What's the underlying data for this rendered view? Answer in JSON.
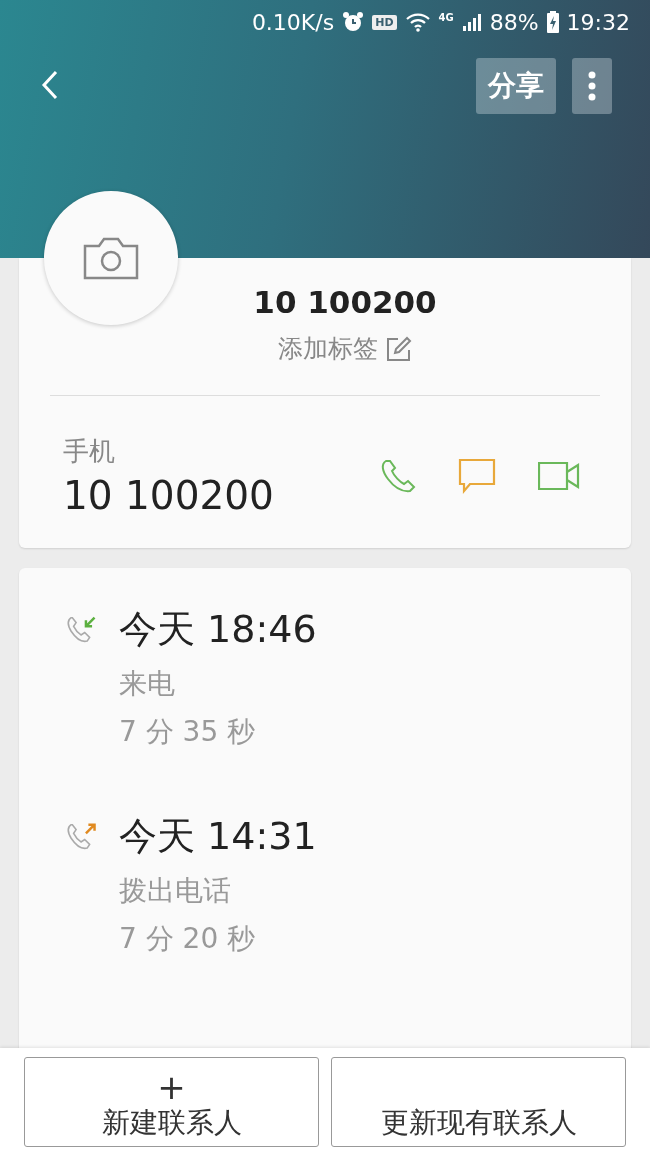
{
  "status_bar": {
    "speed": "0.10K/s",
    "hd": "HD",
    "network": "4G",
    "battery": "88%",
    "time": "19:32"
  },
  "toolbar": {
    "share": "分享"
  },
  "contact": {
    "name": "10 100200",
    "tag_hint": "添加标签"
  },
  "phone": {
    "label": "手机",
    "number": "10 100200"
  },
  "call_log": [
    {
      "kind": "incoming",
      "time": "今天 18:46",
      "type": "来电",
      "duration": "7 分 35 秒"
    },
    {
      "kind": "outgoing",
      "time": "今天 14:31",
      "type": "拨出电话",
      "duration": "7 分 20 秒"
    }
  ],
  "bottom_buttons": [
    {
      "label": "新建联系人",
      "icon": "+"
    },
    {
      "label": "更新现有联系人"
    }
  ]
}
